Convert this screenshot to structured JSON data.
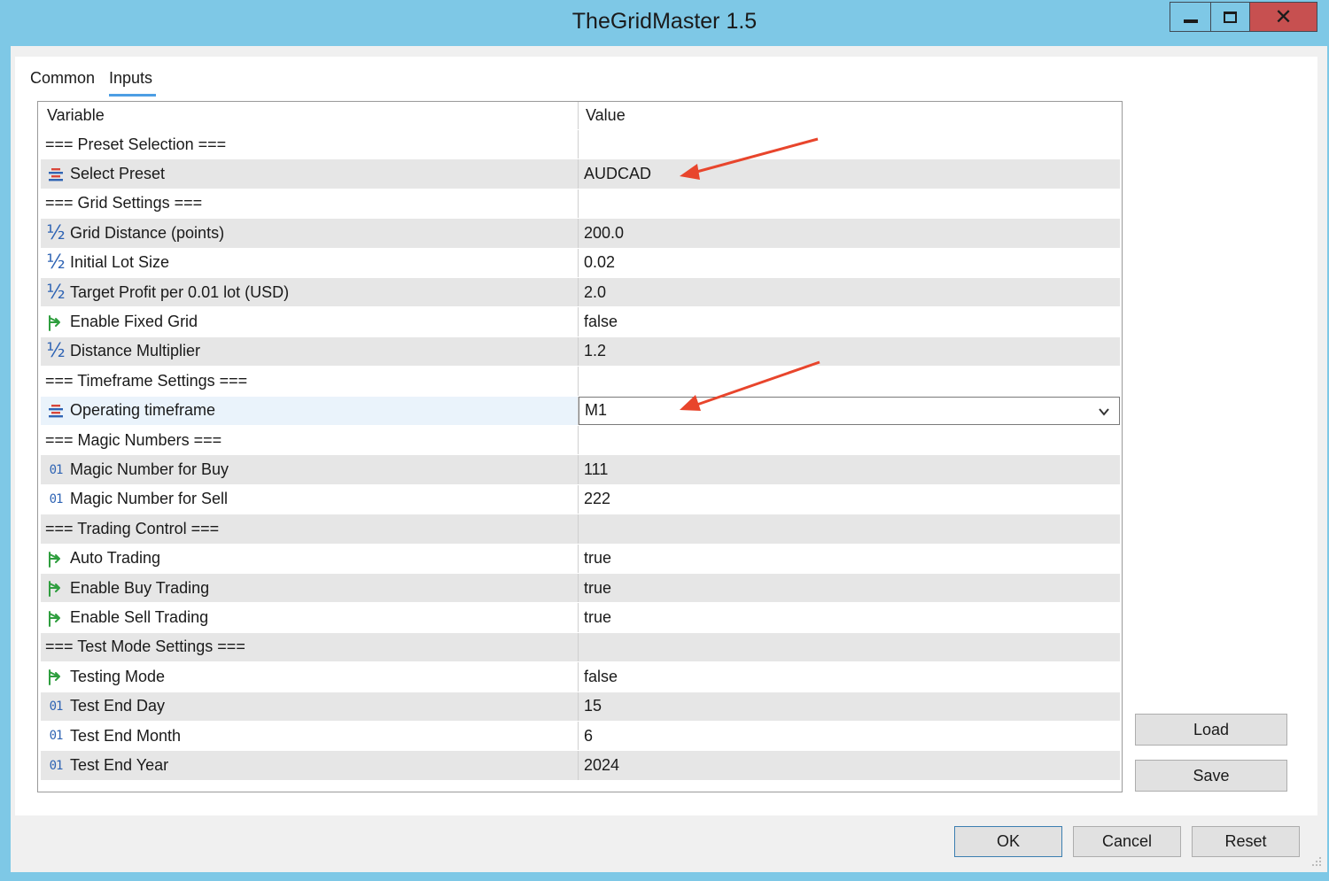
{
  "window": {
    "title": "TheGridMaster 1.5"
  },
  "tabs": {
    "common": "Common",
    "inputs": "Inputs"
  },
  "grid": {
    "header": {
      "variable": "Variable",
      "value": "Value"
    },
    "rows": [
      {
        "label": "=== Preset Selection ===",
        "value": "",
        "icon": "",
        "shade": false
      },
      {
        "label": "Select Preset",
        "value": "AUDCAD",
        "icon": "enum-icon",
        "shade": true
      },
      {
        "label": "=== Grid Settings ===",
        "value": "",
        "icon": "",
        "shade": false
      },
      {
        "label": "Grid Distance (points)",
        "value": "200.0",
        "icon": "double-icon",
        "shade": true
      },
      {
        "label": "Initial Lot Size",
        "value": "0.02",
        "icon": "double-icon",
        "shade": false
      },
      {
        "label": "Target Profit per 0.01 lot (USD)",
        "value": "2.0",
        "icon": "double-icon",
        "shade": true
      },
      {
        "label": "Enable Fixed Grid",
        "value": "false",
        "icon": "bool-icon",
        "shade": false
      },
      {
        "label": "Distance Multiplier",
        "value": "1.2",
        "icon": "double-icon",
        "shade": true
      },
      {
        "label": "=== Timeframe Settings ===",
        "value": "",
        "icon": "",
        "shade": false
      },
      {
        "label": "Operating timeframe",
        "value": "M1",
        "icon": "enum-icon",
        "shade": false,
        "selected": true,
        "dropdown": true
      },
      {
        "label": "=== Magic Numbers ===",
        "value": "",
        "icon": "",
        "shade": false
      },
      {
        "label": "Magic Number for Buy",
        "value": "111",
        "icon": "int-icon",
        "shade": true
      },
      {
        "label": "Magic Number for Sell",
        "value": "222",
        "icon": "int-icon",
        "shade": false
      },
      {
        "label": "=== Trading Control ===",
        "value": "",
        "icon": "",
        "shade": true
      },
      {
        "label": "Auto Trading",
        "value": "true",
        "icon": "bool-icon",
        "shade": false
      },
      {
        "label": "Enable Buy Trading",
        "value": "true",
        "icon": "bool-icon",
        "shade": true
      },
      {
        "label": "Enable Sell Trading",
        "value": "true",
        "icon": "bool-icon",
        "shade": false
      },
      {
        "label": "=== Test Mode Settings ===",
        "value": "",
        "icon": "",
        "shade": true
      },
      {
        "label": "Testing Mode",
        "value": "false",
        "icon": "bool-icon",
        "shade": false
      },
      {
        "label": "Test End Day",
        "value": "15",
        "icon": "int-icon",
        "shade": true
      },
      {
        "label": "Test End Month",
        "value": "6",
        "icon": "int-icon",
        "shade": false
      },
      {
        "label": "Test End Year",
        "value": "2024",
        "icon": "int-icon",
        "shade": true
      }
    ]
  },
  "icon_glyphs": {
    "double": "½",
    "int": "01"
  },
  "buttons": {
    "load": "Load",
    "save": "Save",
    "ok": "OK",
    "cancel": "Cancel",
    "reset": "Reset"
  },
  "colors": {
    "titlebar": "#7ec8e6",
    "close": "#c75050",
    "annotation_arrow": "#e8452c",
    "bool_icon": "#2e9e3e",
    "numeric_icon": "#2f64b4",
    "enum_icon": "#d9473b"
  }
}
